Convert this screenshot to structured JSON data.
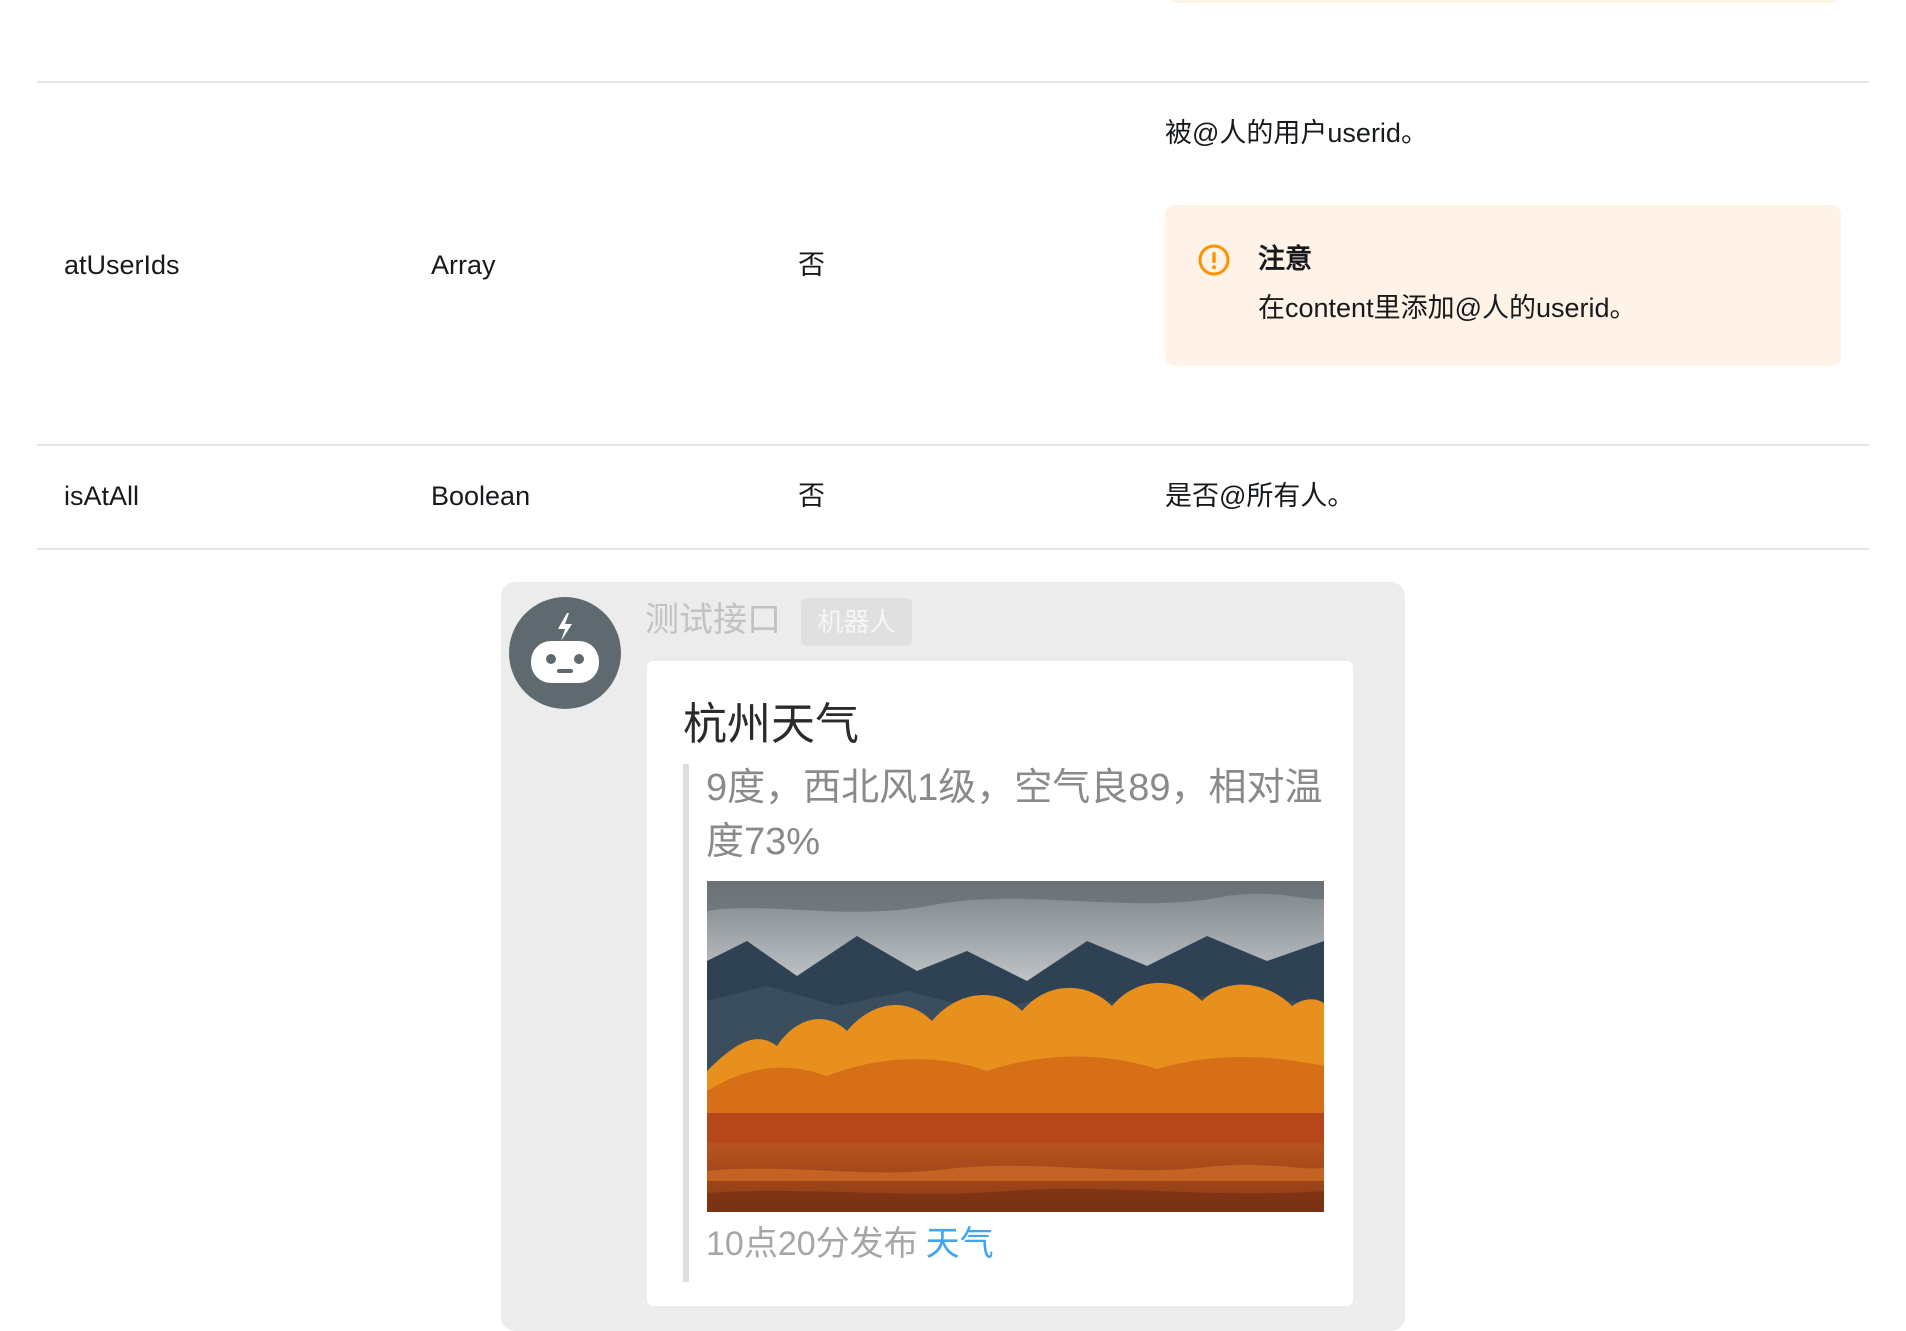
{
  "table": {
    "rows": [
      {
        "name": "atUserIds",
        "type": "Array",
        "required": "否",
        "description": "被@人的用户userid。",
        "note": {
          "title": "注意",
          "text": "在content里添加@人的userid。",
          "icon": "warning-circle-icon"
        }
      },
      {
        "name": "isAtAll",
        "type": "Boolean",
        "required": "否",
        "description": "是否@所有人。"
      }
    ]
  },
  "preview": {
    "sender_name": "测试接口",
    "sender_badge": "机器人",
    "avatar_icon": "robot-icon",
    "card": {
      "title": "杭州天气",
      "text": "9度，西北风1级，空气良89，相对温度73%",
      "image": "autumn-landscape-image",
      "footer_text": "10点20分发布",
      "footer_link": "天气"
    }
  },
  "colors": {
    "note_background": "#fff2e6",
    "warning_icon": "#ff9200",
    "link": "#41a5f5",
    "divider": "#e6e6e6"
  }
}
